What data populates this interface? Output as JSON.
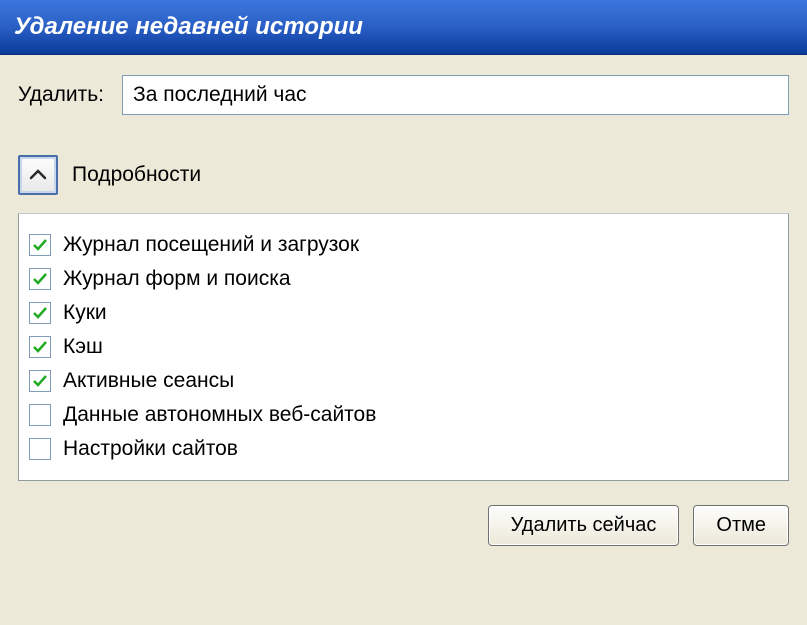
{
  "titlebar": {
    "title": "Удаление недавней истории"
  },
  "timerange": {
    "label": "Удалить:",
    "selected": "За последний час"
  },
  "details": {
    "label": "Подробности"
  },
  "options": [
    {
      "label": "Журнал посещений и загрузок",
      "checked": true
    },
    {
      "label": "Журнал форм и поиска",
      "checked": true
    },
    {
      "label": "Куки",
      "checked": true
    },
    {
      "label": "Кэш",
      "checked": true
    },
    {
      "label": "Активные сеансы",
      "checked": true
    },
    {
      "label": "Данные автономных веб-сайтов",
      "checked": false
    },
    {
      "label": "Настройки сайтов",
      "checked": false
    }
  ],
  "buttons": {
    "clear": "Удалить сейчас",
    "cancel": "Отме"
  }
}
